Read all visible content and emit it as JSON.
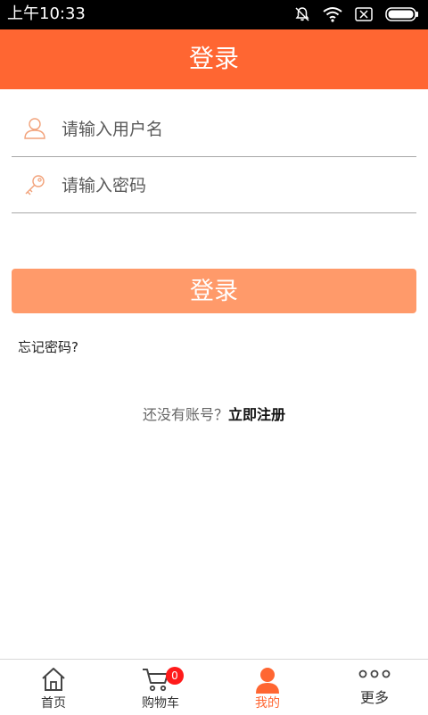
{
  "status_bar": {
    "time": "上午10:33"
  },
  "header": {
    "title": "登录"
  },
  "form": {
    "username_placeholder": "请输入用户名",
    "password_placeholder": "请输入密码",
    "login_button": "登录",
    "forgot_password": "忘记密码?",
    "no_account_text": "还没有账号？",
    "register_link": "立即注册"
  },
  "bottom_nav": {
    "home": "首页",
    "cart": "购物车",
    "cart_badge": "0",
    "mine": "我的",
    "more": "更多"
  },
  "colors": {
    "accent": "#ff6632",
    "button": "#ff9a6a"
  }
}
